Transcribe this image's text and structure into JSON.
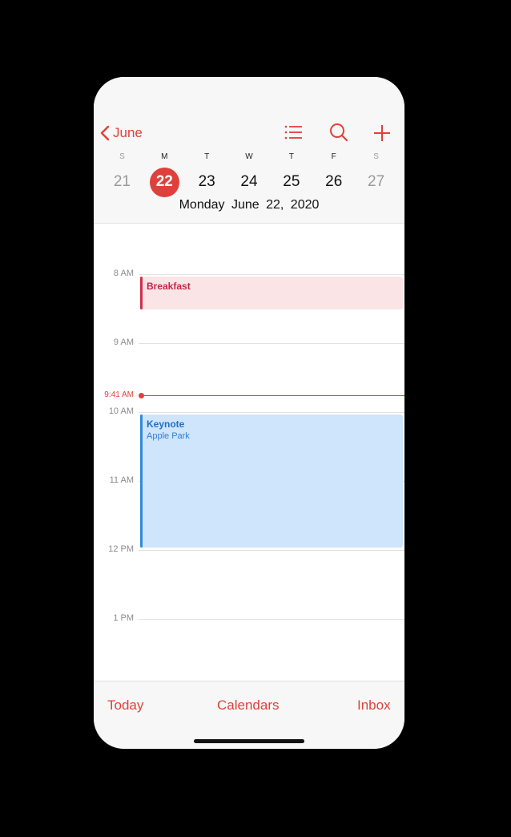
{
  "header": {
    "back_label": "June",
    "week_letters": [
      "S",
      "M",
      "T",
      "W",
      "T",
      "F",
      "S"
    ],
    "week_days": [
      "21",
      "22",
      "23",
      "24",
      "25",
      "26",
      "27"
    ],
    "weekday": "Monday",
    "date": "June 22, 2020",
    "accent_color": "#e0403a"
  },
  "icons": {
    "list": "list-icon",
    "search": "search-icon",
    "add": "plus-icon",
    "back": "chevron-left-icon"
  },
  "timeline": {
    "hours": [
      "8 AM",
      "9 AM",
      "10 AM",
      "11 AM",
      "12 PM",
      "1 PM"
    ],
    "now_label": "9:41 AM",
    "events": [
      {
        "title": "Breakfast",
        "color": "#d0304a"
      },
      {
        "title": "Keynote",
        "location": "Apple Park",
        "color": "#2f8ae0"
      }
    ]
  },
  "tabbar": {
    "today": "Today",
    "calendars": "Calendars",
    "inbox": "Inbox"
  }
}
